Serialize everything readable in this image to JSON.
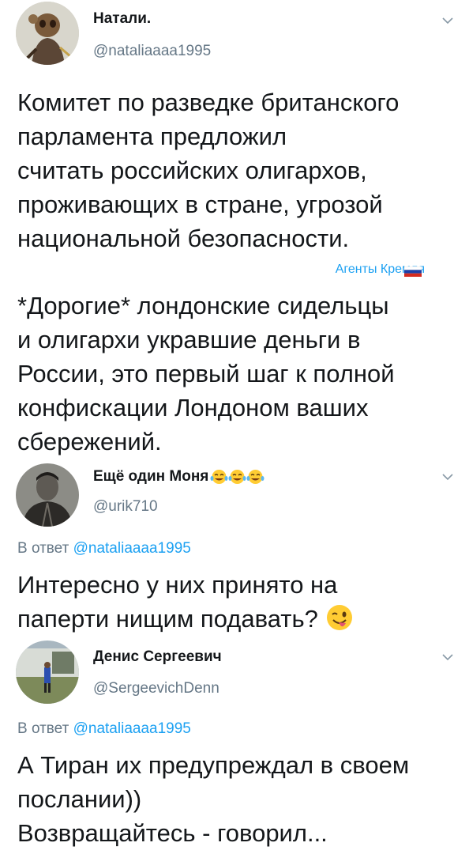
{
  "tweet1": {
    "name": "Натали.",
    "handle": "@nataliaaaa1995",
    "lines": [
      "Комитет по разведке британского",
      "парламента предложил",
      "считать российских олигархов,",
      "проживающих в стране, угрозой",
      "национальной безопасности."
    ],
    "source_label": "Агенты Кремля",
    "flag_icon": "russia-flag-icon",
    "lines2": [
      "*Дорогие* лондонские сидельцы",
      "и олигархи укравшие деньги в",
      "России, это первый шаг к полной",
      "конфискации Лондоном ваших",
      "сбережений."
    ]
  },
  "tweet2": {
    "name": "Ещё один Моня",
    "name_emoji": "tears-of-joy-emoji",
    "handle": "@urik710",
    "reply_prefix": "В ответ",
    "reply_mention": "@nataliaaaa1995",
    "lines": [
      "Интересно у них принято на",
      "паперти нищим подавать?"
    ],
    "emoji": "winking-tongue-emoji"
  },
  "tweet3": {
    "name": "Денис Сергеевич",
    "handle": "@SergeevichDenn",
    "reply_prefix": "В ответ",
    "reply_mention": "@nataliaaaa1995",
    "lines": [
      "А Тиран их предупреждал в своем",
      "послании))",
      "Возвращайтесь - говорил..."
    ]
  },
  "colors": {
    "text": "#14171a",
    "secondary": "#657786",
    "link": "#1da1f2"
  }
}
